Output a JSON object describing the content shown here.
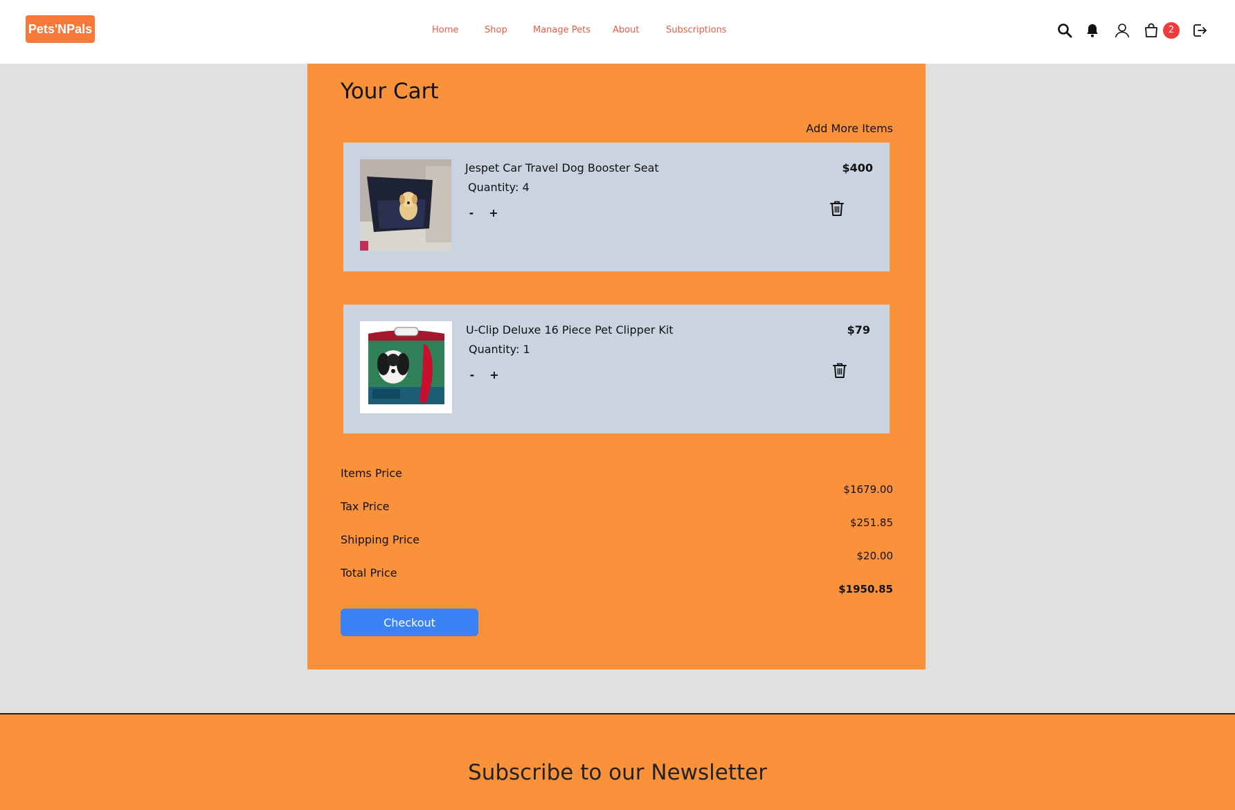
{
  "header": {
    "logo": "Pets'NPals",
    "nav": [
      "Home",
      "Shop",
      "Manage Pets",
      "About",
      "Subscriptions"
    ],
    "cart_count": "2",
    "icons": [
      "search-icon",
      "bell-icon",
      "user-icon",
      "shopping-bag-icon",
      "logout-icon"
    ]
  },
  "cart": {
    "title": "Your Cart",
    "add_more": "Add More Items",
    "items": [
      {
        "name": "Jespet Car Travel Dog Booster Seat",
        "quantity": "Quantity: 4",
        "price": "$400",
        "minus": "-",
        "plus": "+"
      },
      {
        "name": "U-Clip Deluxe 16 Piece Pet Clipper Kit",
        "quantity": "Quantity: 1",
        "price": "$79",
        "minus": "-",
        "plus": "+"
      }
    ]
  },
  "summary": {
    "items_label": "Items Price",
    "items_value": "$1679.00",
    "tax_label": "Tax Price",
    "tax_value": "$251.85",
    "shipping_label": "Shipping Price",
    "shipping_value": "$20.00",
    "total_label": "Total Price",
    "total_value": "$1950.85"
  },
  "checkout_label": "Checkout",
  "footer": {
    "newsletter_title": "Subscribe to our Newsletter"
  },
  "colors": {
    "accent_orange": "#fa913b",
    "logo_orange": "#f6793a",
    "nav_text": "#e35d4a",
    "item_card": "#cad4e0",
    "checkout_blue": "#3b82f6",
    "badge_red": "#ef3b3b",
    "page_bg": "#e0e0e0"
  }
}
